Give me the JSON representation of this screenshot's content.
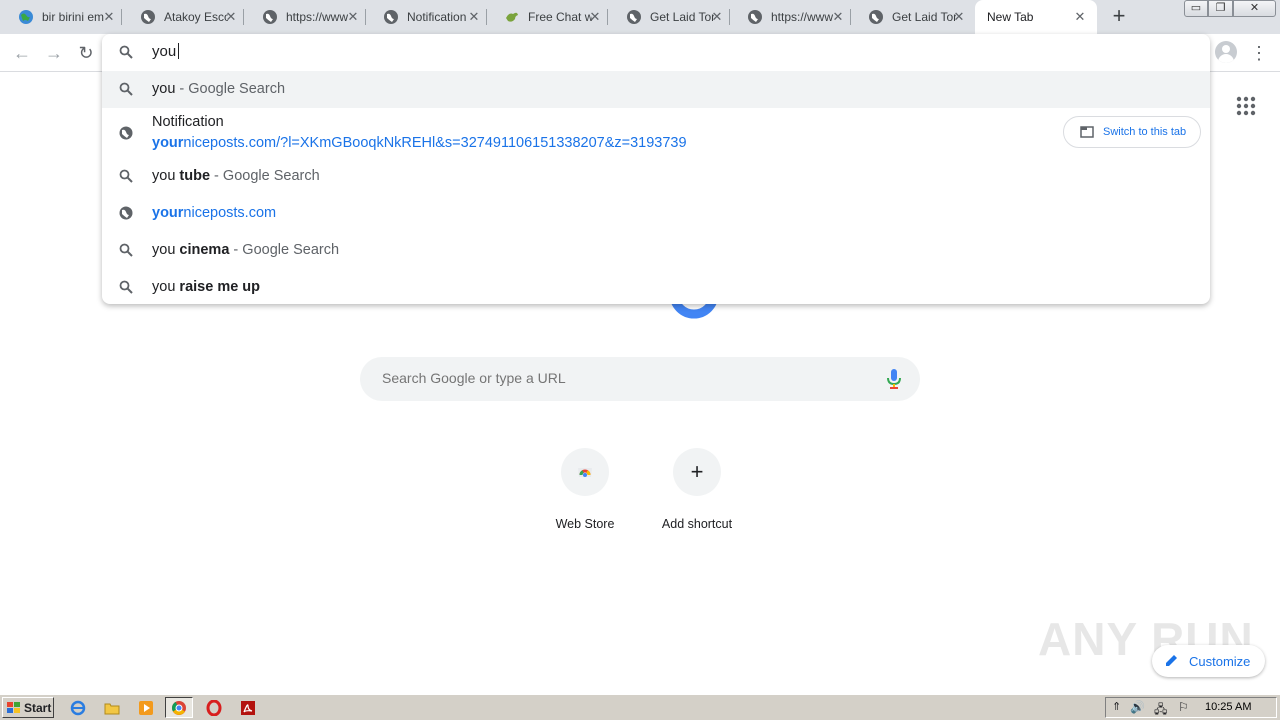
{
  "tabs": [
    {
      "title": "bir birini em",
      "favicon": "earth-icon",
      "active": false
    },
    {
      "title": "Atakoy Esco",
      "favicon": "globe-icon",
      "active": false
    },
    {
      "title": "https://www",
      "favicon": "globe-icon",
      "active": false
    },
    {
      "title": "Notification",
      "favicon": "globe-icon",
      "active": false
    },
    {
      "title": "Free Chat w",
      "favicon": "bird-icon",
      "active": false
    },
    {
      "title": "Get Laid Tor",
      "favicon": "globe-icon",
      "active": false
    },
    {
      "title": "https://www",
      "favicon": "globe-icon",
      "active": false
    },
    {
      "title": "Get Laid Tor",
      "favicon": "globe-icon",
      "active": false
    },
    {
      "title": "New Tab",
      "favicon": "",
      "active": true
    }
  ],
  "omnibox": {
    "input_text": "you",
    "suggestions": [
      {
        "icon": "search-icon",
        "text": "you",
        "suffix": " - Google Search",
        "selected": true
      },
      {
        "icon": "globe-icon",
        "text": "Notification",
        "url_bold": "your",
        "url_rest": "niceposts.com/?l=XKmGBooqkNkREHl&s=327491106151338207&z=3193739"
      },
      {
        "icon": "search-icon",
        "text": "you ",
        "bold": "tube",
        "suffix": " - Google Search"
      },
      {
        "icon": "globe-icon",
        "url_bold": "your",
        "url_rest": "niceposts.com"
      },
      {
        "icon": "search-icon",
        "text": "you ",
        "bold": "cinema",
        "suffix": " - Google Search"
      },
      {
        "icon": "search-icon",
        "text": "you ",
        "bold": "raise me up",
        "suffix": ""
      }
    ],
    "switch_tab_label": "Switch to this tab"
  },
  "ntp": {
    "search_placeholder": "Search Google or type a URL",
    "shortcuts": [
      {
        "label": "Web Store",
        "icon": "webstore-icon"
      },
      {
        "label": "Add shortcut",
        "icon": "plus-icon"
      }
    ],
    "customize_label": "Customize",
    "watermark": "ANY RUN"
  },
  "taskbar": {
    "start_label": "Start",
    "clock": "10:25 AM"
  },
  "colors": {
    "accent": "#1a73e8",
    "tabstrip": "#dee1e6",
    "taskbar": "#d4d0c8"
  }
}
